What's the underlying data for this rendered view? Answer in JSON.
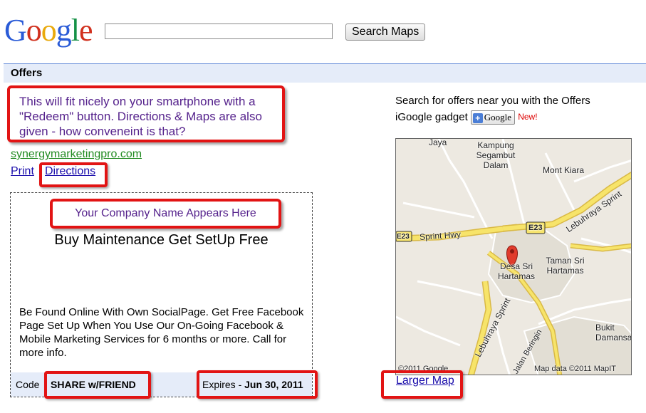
{
  "header": {
    "logo_text": "Google",
    "search_value": "",
    "search_button": "Search Maps"
  },
  "offers": {
    "section_title": "Offers",
    "callout_1": "This will fit nicely on your smartphone with a \"Redeem\" button. Directions & Maps are also given - how conveneint is that?",
    "site_url": "synergymarketingpro.com",
    "print_link": "Print",
    "directions_link": "Directions",
    "callout_2": "Your Company Name Appears Here",
    "deal_title": "Buy Maintenance Get SetUp Free",
    "deal_description": "Be Found Online With Own SocialPage. Get Free Facebook Page Set Up When You Use Our On-Going Facebook & Mobile Marketing Services for 6 months or more. Call for more info.",
    "code_label": "Code",
    "code_value": "SHARE w/FRIEND",
    "expires_label": "Expires -",
    "expires_value": "Jun 30, 2011"
  },
  "sidebar": {
    "gadget_text": "Search for offers near you with the Offers iGoogle gadget",
    "gadget_button": "Google",
    "new_badge": "New!",
    "larger_map_link": "Larger Map"
  },
  "map": {
    "labels": {
      "jaya": "Jaya",
      "kampung": "Kampung Segambut Dalam",
      "mont_kiara": "Mont Kiara",
      "lebuhraya_sprint_1": "Lebuhraya Sprint",
      "sprint_hwy": "Sprint Hwy",
      "e23_left": "E23",
      "e23_mid": "E23",
      "desa": "Desa Sri Hartamas",
      "taman": "Taman Sri Hartamas",
      "lebuhraya_sprint_2": "Lebuhraya Sprint",
      "bukit": "Bukit Damansar",
      "jalan_beringin": "Jalan Beringin",
      "copyright": "©2011 Google",
      "map_data": "Map data ©2011 MapIT"
    },
    "colors": {
      "land": "#ede9e1",
      "highway": "#f7e46a",
      "highway_edge": "#d9b946",
      "local_road": "#ffffff",
      "pin": "#e03b2c"
    }
  },
  "theme": {
    "annotation_red": "#e21414",
    "annotation_text": "#55228c",
    "link_blue": "#1a0dab",
    "url_green": "#228b22",
    "bar_blue": "#e5ecf9"
  }
}
